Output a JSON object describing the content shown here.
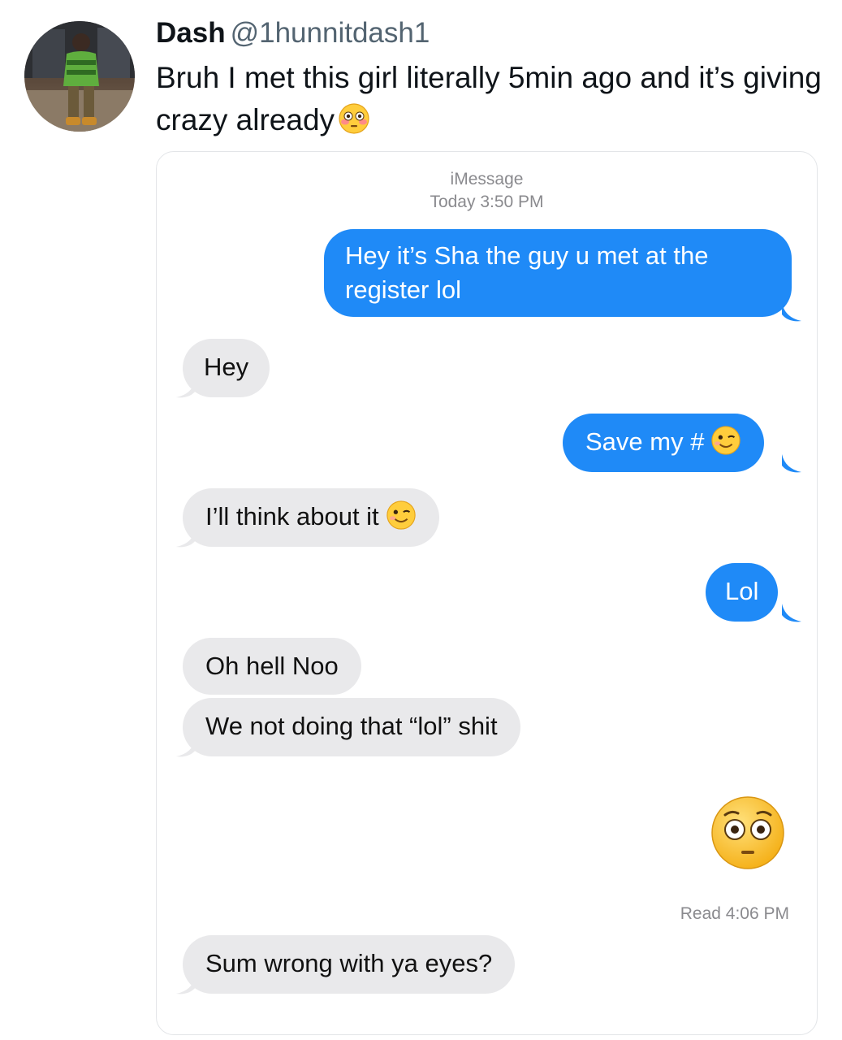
{
  "tweet": {
    "display_name": "Dash",
    "handle": "@1hunnitdash1",
    "text": "Bruh I met this girl literally 5min ago and it’s giving crazy already",
    "emoji": "flushed-face-icon"
  },
  "imessage": {
    "service": "iMessage",
    "timestamp": "Today 3:50 PM",
    "messages": [
      {
        "direction": "outgoing",
        "text": "Hey it’s Sha the guy u met at the register lol"
      },
      {
        "direction": "incoming",
        "text": "Hey"
      },
      {
        "direction": "outgoing",
        "text": "Save my #",
        "emoji": "winking-face-icon"
      },
      {
        "direction": "incoming",
        "text": "I’ll think about it",
        "emoji": "winking-face-icon"
      },
      {
        "direction": "outgoing",
        "text": "Lol"
      },
      {
        "direction": "incoming",
        "text": "Oh hell Noo"
      },
      {
        "direction": "incoming",
        "text": "We not doing that “lol” shit"
      },
      {
        "direction": "outgoing",
        "emoji": "flushed-face-icon"
      },
      {
        "direction": "incoming",
        "text": "Sum wrong with ya eyes?"
      }
    ],
    "read_receipt": "Read 4:06 PM"
  },
  "colors": {
    "outgoing_bubble": "#1f8af7",
    "incoming_bubble": "#e9e9eb",
    "handle_gray": "#536471",
    "meta_gray": "#8a8a8e"
  }
}
